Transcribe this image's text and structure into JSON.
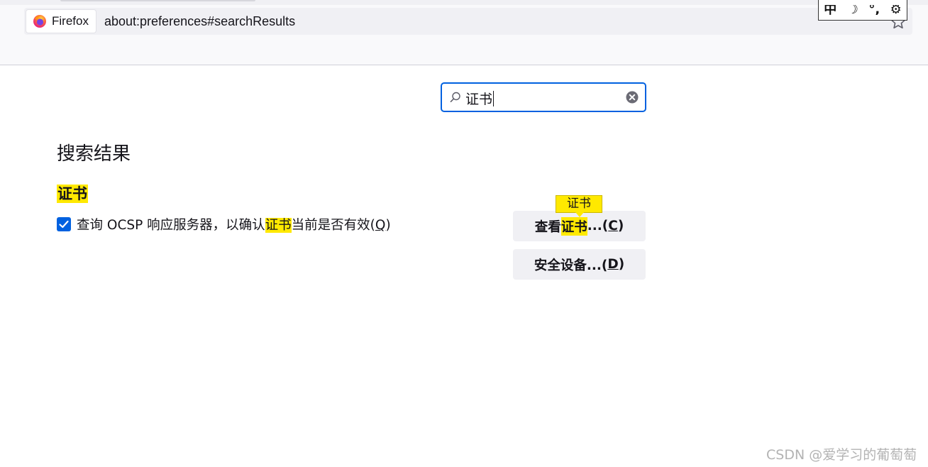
{
  "browser": {
    "identity_label": "Firefox",
    "url": "about:preferences#searchResults",
    "ime": [
      "中",
      "☽",
      "°,",
      "⚙"
    ]
  },
  "search": {
    "value": "证书"
  },
  "results": {
    "heading": "搜索结果",
    "section_title": "证书",
    "checkbox": {
      "checked": true,
      "label_before": "查询 OCSP 响应服务器，以确认",
      "label_highlight": "证书",
      "label_after": "当前是否有效(",
      "accesskey": "Q",
      "label_close": ")"
    },
    "buttons": {
      "view_before": "查看",
      "view_highlight": "证书",
      "view_after": "...(",
      "view_accesskey": "C",
      "view_close": ")",
      "devices_label": "安全设备...(",
      "devices_accesskey": "D",
      "devices_close": ")"
    },
    "tooltip": "证书"
  },
  "watermark": "CSDN @爱学习的葡萄萄",
  "colors": {
    "accent": "#0061e0",
    "highlight": "#ffe900",
    "button_bg": "#f0f0f4"
  }
}
